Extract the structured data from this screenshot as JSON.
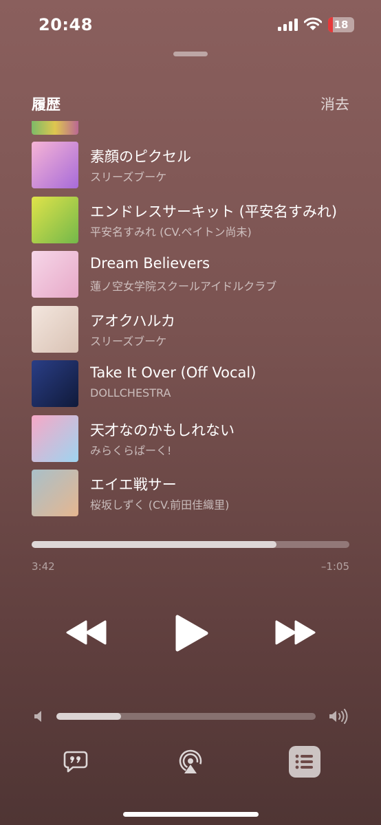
{
  "status_bar": {
    "time": "20:48",
    "battery_level": "18",
    "icons": [
      "signal-icon",
      "wifi-icon",
      "battery-icon"
    ]
  },
  "history": {
    "title": "履歴",
    "clear_label": "消去"
  },
  "tracks": [
    {
      "title": "素顔のピクセル",
      "artist": "スリーズブーケ",
      "art_colors": [
        "#f6b4d6",
        "#a76bd8"
      ]
    },
    {
      "title": "エンドレスサーキット (平安名すみれ)",
      "artist": "平安名すみれ (CV.ペイトン尚未)",
      "art_colors": [
        "#e0e34a",
        "#73b84a"
      ]
    },
    {
      "title": "Dream Believers",
      "artist": "蓮ノ空女学院スクールアイドルクラブ",
      "art_colors": [
        "#f6d6e8",
        "#e7a9c8"
      ]
    },
    {
      "title": "アオクハルカ",
      "artist": "スリーズブーケ",
      "art_colors": [
        "#f3e6de",
        "#d9c2b4"
      ]
    },
    {
      "title": "Take It Over (Off Vocal)",
      "artist": "DOLLCHESTRA",
      "art_colors": [
        "#2a3e86",
        "#101a3a"
      ]
    },
    {
      "title": "天才なのかもしれない",
      "artist": "みらくらぱーく!",
      "art_colors": [
        "#f7a8c6",
        "#9ed4f0"
      ]
    },
    {
      "title": "エイエ戦サー",
      "artist": "桜坂しずく (CV.前田佳織里)",
      "art_colors": [
        "#a9c0c9",
        "#e5b690"
      ]
    }
  ],
  "playback": {
    "elapsed": "3:42",
    "remaining": "–1:05",
    "progress": 0.77
  },
  "controls": {
    "rewind": "rewind-icon",
    "play": "play-icon",
    "forward": "forward-icon"
  },
  "volume": {
    "level": 0.25
  },
  "bottom_bar": {
    "lyrics": "lyrics-icon",
    "airplay": "airplay-icon",
    "queue": "queue-icon"
  },
  "colors": {
    "background": "#7a5351",
    "text": "#ffffff",
    "battery_low": "#e5393a"
  }
}
